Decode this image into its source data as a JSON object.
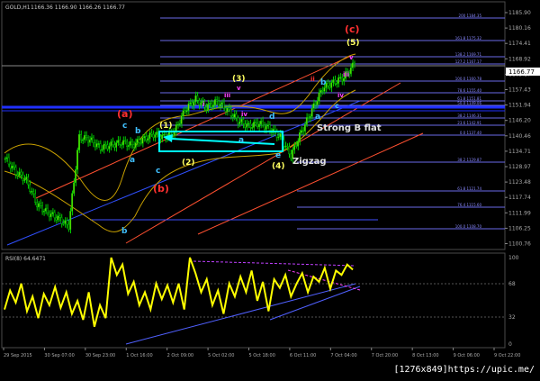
{
  "header": {
    "symbol": "GOLD,H1",
    "quote": "1166.36 1166.90 1166.26 1166.77"
  },
  "price_panel": {
    "scale": [
      "1185.90",
      "1180.16",
      "1174.41",
      "1168.92",
      "1163.17",
      "1157.43",
      "1151.94",
      "1146.20",
      "1140.46",
      "1134.71",
      "1128.97",
      "1123.48",
      "1117.74",
      "1111.99",
      "1106.25",
      "1100.76"
    ],
    "current_price": "1166.77",
    "fib_levels": [
      "200 1184.35",
      "161.8 1175.32",
      "138.2 1169.71",
      "127.2 1167.17",
      "100.0 1160.78",
      "78.6 1155.40",
      "61.8 1151.81",
      "50.0 1149.06",
      "38.2 1146.31",
      "23.6 1142.91",
      "0.0 1137.40",
      "38.2 1129.87",
      "61.8 1121.74",
      "76.4 1115.60",
      "100.0 1108.70"
    ]
  },
  "rsi_panel": {
    "label": "RSI(8) 64.6471",
    "scale": [
      "100",
      "68",
      "32",
      "0"
    ]
  },
  "time_axis": [
    "29 Sep 2015",
    "30 Sep 07:00",
    "30 Sep 23:00",
    "1 Oct 16:00",
    "2 Oct 09:00",
    "5 Oct 02:00",
    "5 Oct 18:00",
    "6 Oct 11:00",
    "7 Oct 04:00",
    "7 Oct 20:00",
    "8 Oct 13:00",
    "9 Oct 06:00",
    "9 Oct 22:00"
  ],
  "annotations": {
    "wave_a_big": "(a)",
    "wave_b_big": "(b)",
    "wave_c_big": "(c)",
    "w1": "(1)",
    "w2": "(2)",
    "w3": "(3)",
    "w4": "(4)",
    "w5": "(5)",
    "a": "a",
    "b": "b",
    "c": "c",
    "d": "d",
    "e": "e",
    "i": "i",
    "ii": "ii",
    "iii": "iii",
    "iv": "iv",
    "v": "v",
    "strong_b_flat": "Strong B flat",
    "zigzag": "Zigzag"
  },
  "colors": {
    "price_up": "#00cc00",
    "price_body": "#7fe000",
    "rsi_line": "#ffff00",
    "fib": "#6a6ae8",
    "channel": "#ff5030",
    "box": "#00ffff",
    "bands": "#c8a000",
    "wave_red": "#ff3030",
    "wave_yellow": "#ffff60",
    "wave_cyan": "#40c0ff",
    "wave_magenta": "#ff40ff"
  },
  "chart_data": [
    {
      "type": "candlestick",
      "title": "GOLD,H1",
      "ylim": [
        1100.76,
        1185.9
      ],
      "x": [
        "29 Sep 2015",
        "30 Sep 07:00",
        "30 Sep 23:00",
        "1 Oct 16:00",
        "2 Oct 09:00",
        "5 Oct 02:00",
        "5 Oct 18:00",
        "6 Oct 11:00",
        "7 Oct 04:00",
        "7 Oct 20:00",
        "8 Oct 13:00",
        "9 Oct 06:00",
        "9 Oct 22:00"
      ],
      "series": [
        {
          "values": [
            1132,
            1127,
            1124,
            1115,
            1112,
            1110,
            1107,
            1140,
            1139,
            1136,
            1137,
            1138,
            1137,
            1139,
            1141,
            1140,
            1142,
            1150,
            1154,
            1151,
            1153,
            1150,
            1146,
            1144,
            1145,
            1143,
            1140,
            1133,
            1142,
            1150,
            1158,
            1160,
            1162,
            1167
          ]
        }
      ]
    },
    {
      "type": "line",
      "title": "RSI(8) 64.6471",
      "ylim": [
        0,
        100
      ],
      "series": [
        {
          "values": [
            40,
            62,
            48,
            70,
            38,
            55,
            30,
            58,
            45,
            66,
            42,
            60,
            35,
            50,
            28,
            60,
            20,
            45,
            30,
            100,
            80,
            92,
            58,
            72,
            45,
            60,
            40,
            70,
            52,
            68,
            48,
            70,
            40,
            100,
            82,
            60,
            75,
            45,
            62,
            35,
            70,
            55,
            78,
            60,
            85,
            50,
            72,
            38,
            75,
            65,
            80,
            55,
            70,
            82,
            60,
            78,
            72,
            88,
            64,
            85,
            80,
            92,
            86
          ]
        }
      ]
    }
  ]
}
